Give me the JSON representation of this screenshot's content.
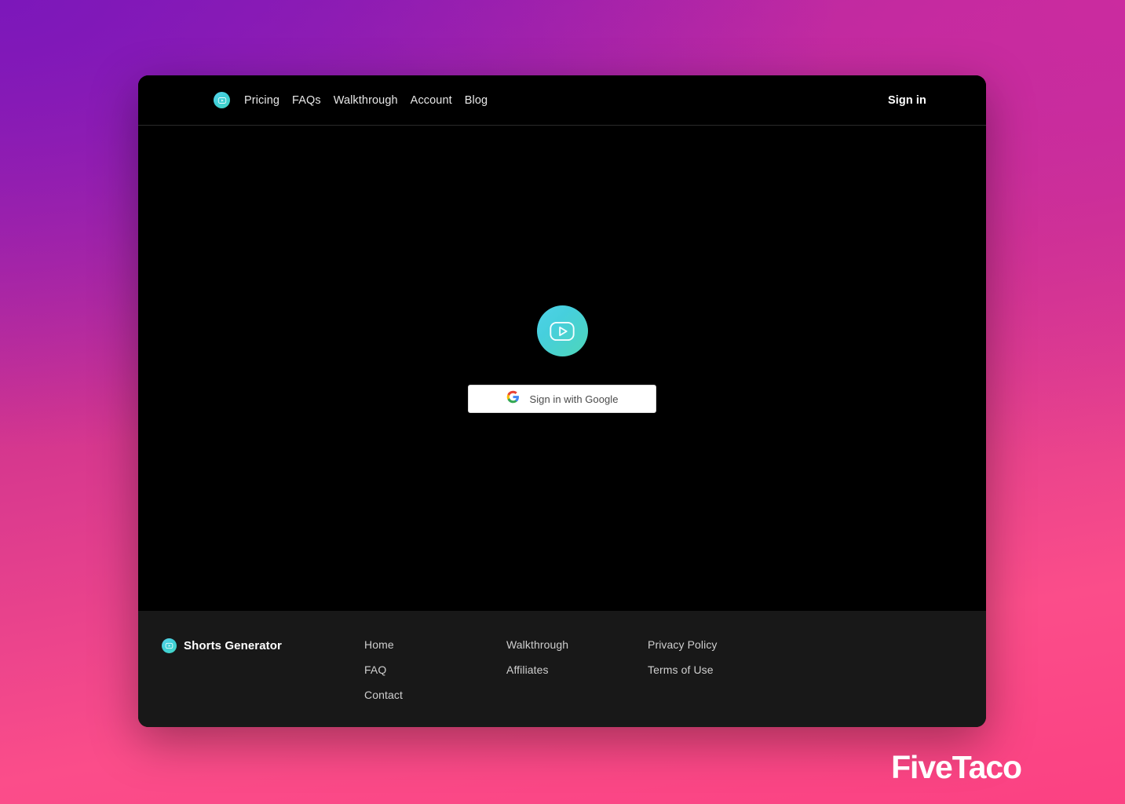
{
  "background": {
    "gradient_top_left": "#7c17ba",
    "gradient_top_right": "#cb2b9f",
    "gradient_bottom_left": "#fb4e8b",
    "gradient_bottom_right": "#fa4084"
  },
  "header": {
    "logo_icon": "play-rect-icon",
    "nav": [
      {
        "label": "Pricing",
        "name": "nav-link-pricing"
      },
      {
        "label": "FAQs",
        "name": "nav-link-faqs"
      },
      {
        "label": "Walkthrough",
        "name": "nav-link-walkthrough"
      },
      {
        "label": "Account",
        "name": "nav-link-account"
      },
      {
        "label": "Blog",
        "name": "nav-link-blog"
      }
    ],
    "signin_label": "Sign in",
    "background_color": "#000000"
  },
  "main": {
    "background_color": "#000000",
    "hero_logo_icon": "play-rect-icon",
    "hero_logo_gradient_from": "#4fd3e8",
    "hero_logo_gradient_to": "#4ed6b9",
    "google_button": {
      "icon": "google-g-icon",
      "label": "Sign in with Google",
      "background_color": "#ffffff",
      "text_color": "#4a4a4a"
    }
  },
  "footer": {
    "background_color": "#181818",
    "brand_name": "Shorts Generator",
    "brand_icon": "play-rect-icon",
    "columns": [
      {
        "name": "footer-column-1",
        "links": [
          {
            "label": "Home",
            "name": "footer-link-home"
          },
          {
            "label": "FAQ",
            "name": "footer-link-faq"
          },
          {
            "label": "Contact",
            "name": "footer-link-contact"
          }
        ]
      },
      {
        "name": "footer-column-2",
        "links": [
          {
            "label": "Walkthrough",
            "name": "footer-link-walkthrough"
          },
          {
            "label": "Affiliates",
            "name": "footer-link-affiliates"
          }
        ]
      },
      {
        "name": "footer-column-3",
        "links": [
          {
            "label": "Privacy Policy",
            "name": "footer-link-privacy-policy"
          },
          {
            "label": "Terms of Use",
            "name": "footer-link-terms-of-use"
          }
        ]
      }
    ]
  },
  "watermark": {
    "text": "FiveTaco",
    "color": "#ffffff"
  }
}
